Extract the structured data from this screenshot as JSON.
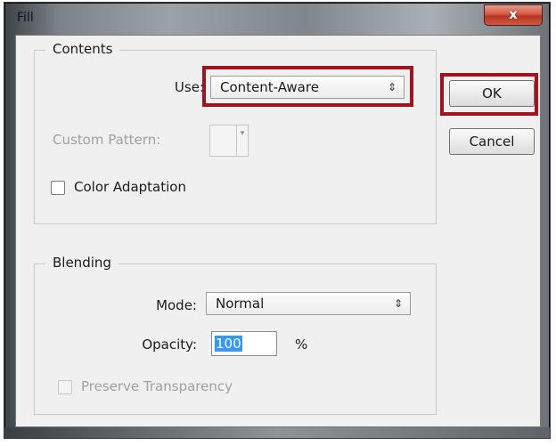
{
  "dialog": {
    "title": "Fill",
    "close_glyph": "x"
  },
  "contents": {
    "legend": "Contents",
    "use_label": "Use:",
    "use_value": "Content-Aware",
    "custom_pattern_label": "Custom Pattern:",
    "color_adaptation_label": "Color Adaptation",
    "color_adaptation_checked": false
  },
  "blending": {
    "legend": "Blending",
    "mode_label": "Mode:",
    "mode_value": "Normal",
    "opacity_label": "Opacity:",
    "opacity_value": "100",
    "opacity_unit": "%",
    "preserve_transparency_label": "Preserve Transparency",
    "preserve_transparency_checked": false
  },
  "buttons": {
    "ok": "OK",
    "cancel": "Cancel"
  },
  "icons": {
    "select_arrows": "⇕",
    "dropdown_arrow": "▾"
  },
  "colors": {
    "highlight": "#a3121b",
    "close_button": "#c94a34",
    "selection": "#3399ff"
  }
}
